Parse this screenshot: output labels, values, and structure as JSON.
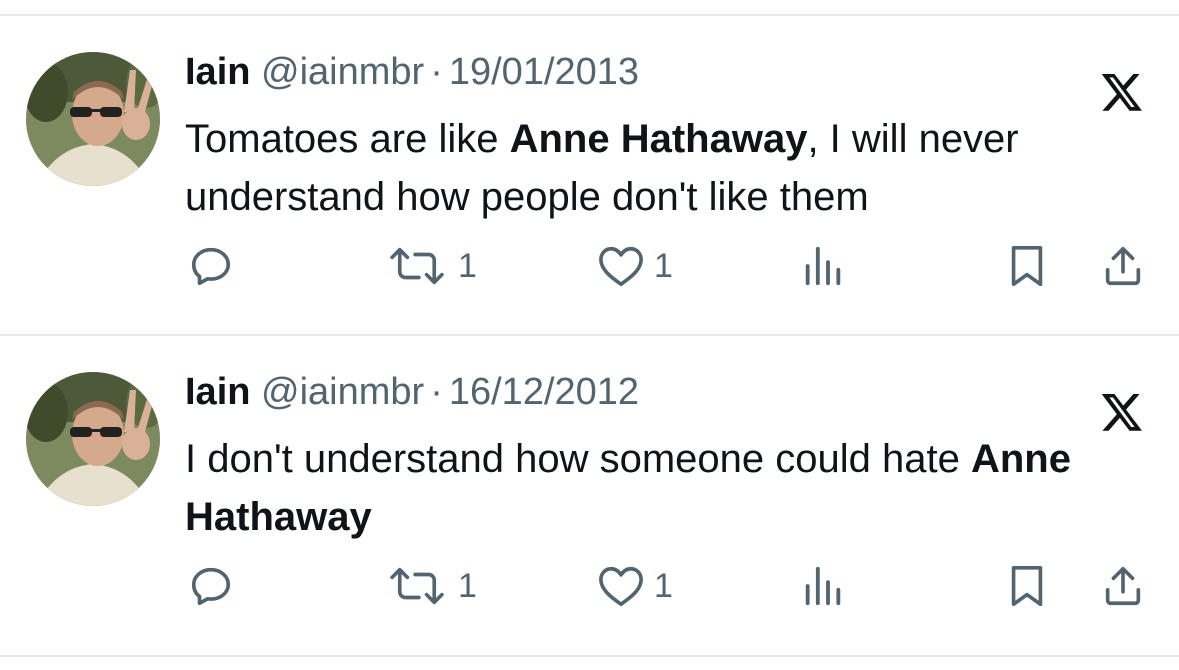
{
  "tweets": [
    {
      "display_name": "Iain",
      "handle": "@iainmbr",
      "separator": "·",
      "date": "19/01/2013",
      "text_parts": [
        "Tomatoes are like ",
        "Anne Hathaway",
        ", I will never understand how people don't like them"
      ],
      "retweets": "1",
      "likes": "1"
    },
    {
      "display_name": "Iain",
      "handle": "@iainmbr",
      "separator": "·",
      "date": "16/12/2012",
      "text_parts": [
        "I don't understand how someone could hate ",
        "Anne Hathaway",
        ""
      ],
      "retweets": "1",
      "likes": "1"
    }
  ],
  "icons": {
    "brand": "x-logo-icon",
    "reply": "reply-icon",
    "retweet": "retweet-icon",
    "like": "heart-icon",
    "views": "views-chart-icon",
    "bookmark": "bookmark-icon",
    "share": "share-icon"
  },
  "colors": {
    "text": "#0f1419",
    "secondary": "#536471",
    "divider": "#e6e9ec"
  }
}
